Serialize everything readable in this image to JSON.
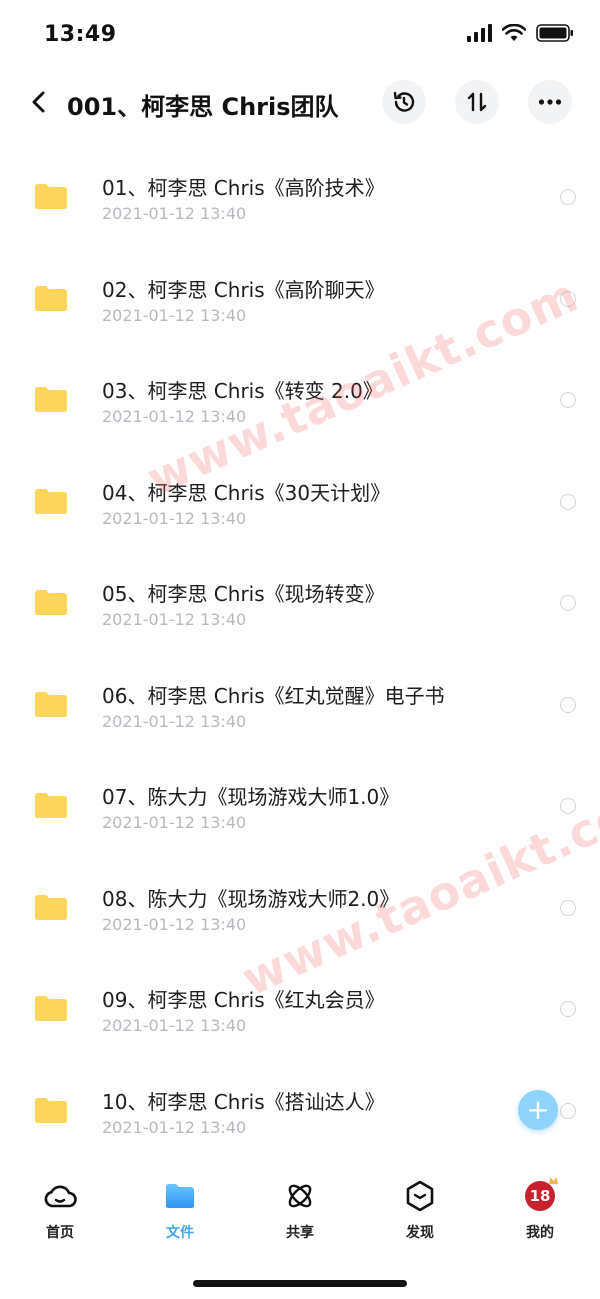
{
  "status_bar": {
    "time": "13:49"
  },
  "header": {
    "title": "001、柯李思 Chris团队"
  },
  "files": [
    {
      "name": "01、柯李思 Chris《高阶技术》",
      "date": "2021-01-12 13:40"
    },
    {
      "name": "02、柯李思 Chris《高阶聊天》",
      "date": "2021-01-12 13:40"
    },
    {
      "name": "03、柯李思 Chris《转变 2.0》",
      "date": "2021-01-12 13:40"
    },
    {
      "name": "04、柯李思 Chris《30天计划》",
      "date": "2021-01-12 13:40"
    },
    {
      "name": "05、柯李思 Chris《现场转变》",
      "date": "2021-01-12 13:40"
    },
    {
      "name": "06、柯李思 Chris《红丸觉醒》电子书",
      "date": "2021-01-12 13:40"
    },
    {
      "name": "07、陈大力《现场游戏大师1.0》",
      "date": "2021-01-12 13:40"
    },
    {
      "name": "08、陈大力《现场游戏大师2.0》",
      "date": "2021-01-12 13:40"
    },
    {
      "name": "09、柯李思 Chris《红丸会员》",
      "date": "2021-01-12 13:40"
    },
    {
      "name": "10、柯李思 Chris《搭讪达人》",
      "date": "2021-01-12 13:40"
    }
  ],
  "fab": {
    "symbol": "+"
  },
  "watermark": {
    "text": "www.taoaikt.com"
  },
  "tabs": [
    {
      "label": "首页",
      "icon": "cloud-icon"
    },
    {
      "label": "文件",
      "icon": "folder-icon",
      "active": true
    },
    {
      "label": "共享",
      "icon": "atom-icon"
    },
    {
      "label": "发现",
      "icon": "discover-icon"
    },
    {
      "label": "我的",
      "icon": "avatar",
      "avatar_text": "18"
    }
  ],
  "colors": {
    "accent": "#3aa7f2",
    "folder": "#fcd65a",
    "fab": "#8fd3fb",
    "watermark": "#eb5050",
    "avatar": "#c6212c"
  }
}
